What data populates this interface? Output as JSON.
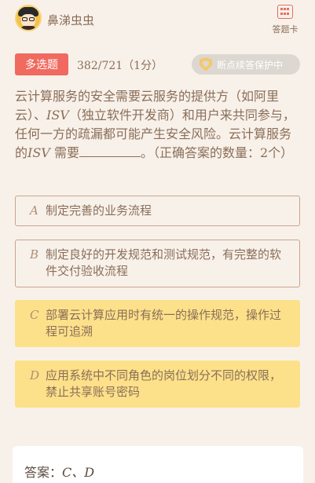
{
  "header": {
    "username": "鼻涕虫虫",
    "answer_card_label": "答题卡",
    "avatar_icon": "avatar-icon",
    "card_icon": "grid-icon"
  },
  "meta": {
    "type_tag": "多选题",
    "progress": "382/721（1分）",
    "protect_label": "断点续答保护中"
  },
  "question": {
    "part1": "云计算服务的安全需要云服务的提供方（如阿里云）、",
    "isv1": "ISV",
    "part2": "（独立软件开发商）和用户来共同参与，任何一方的疏漏都可能产生安全风险。云计算服务的",
    "isv2": "ISV",
    "part3": "需要",
    "part4": "。（正确答案的数量：2个）"
  },
  "options": [
    {
      "letter": "A",
      "text": "制定完善的业务流程",
      "selected": false
    },
    {
      "letter": "B",
      "text": "制定良好的开发规范和测试规范，有完整的软件交付验收流程",
      "selected": false
    },
    {
      "letter": "C",
      "text": "部署云计算应用时有统一的操作规范，操作过程可追溯",
      "selected": true
    },
    {
      "letter": "D",
      "text": "应用系统中不同角色的岗位划分不同的权限，禁止共享账号密码",
      "selected": true
    }
  ],
  "answer": {
    "label": "答案：",
    "value": "C、D"
  },
  "colors": {
    "background": "#f8f1ea",
    "tag": "#f06a60",
    "selected": "#fde18a",
    "text": "#8a6e58"
  }
}
